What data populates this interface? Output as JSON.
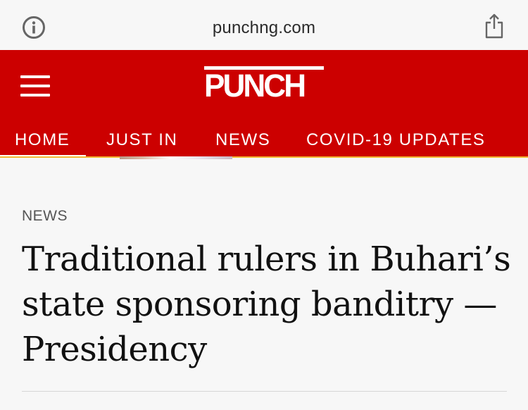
{
  "browser": {
    "url": "punchng.com",
    "icons": [
      "info-icon",
      "share-icon"
    ]
  },
  "header": {
    "logo_text": "PUNCH",
    "brand_color": "#cc0000",
    "menu_icon": "hamburger-menu-icon"
  },
  "nav": {
    "items": [
      {
        "label": "HOME",
        "active": true
      },
      {
        "label": "JUST IN",
        "active": false
      },
      {
        "label": "NEWS",
        "active": false
      },
      {
        "label": "COVID-19 UPDATES",
        "active": false
      }
    ]
  },
  "article": {
    "category": "NEWS",
    "headline_lines": [
      "Traditional rulers in Buhari’s",
      "state sponsoring banditry —",
      "Presidency"
    ]
  }
}
